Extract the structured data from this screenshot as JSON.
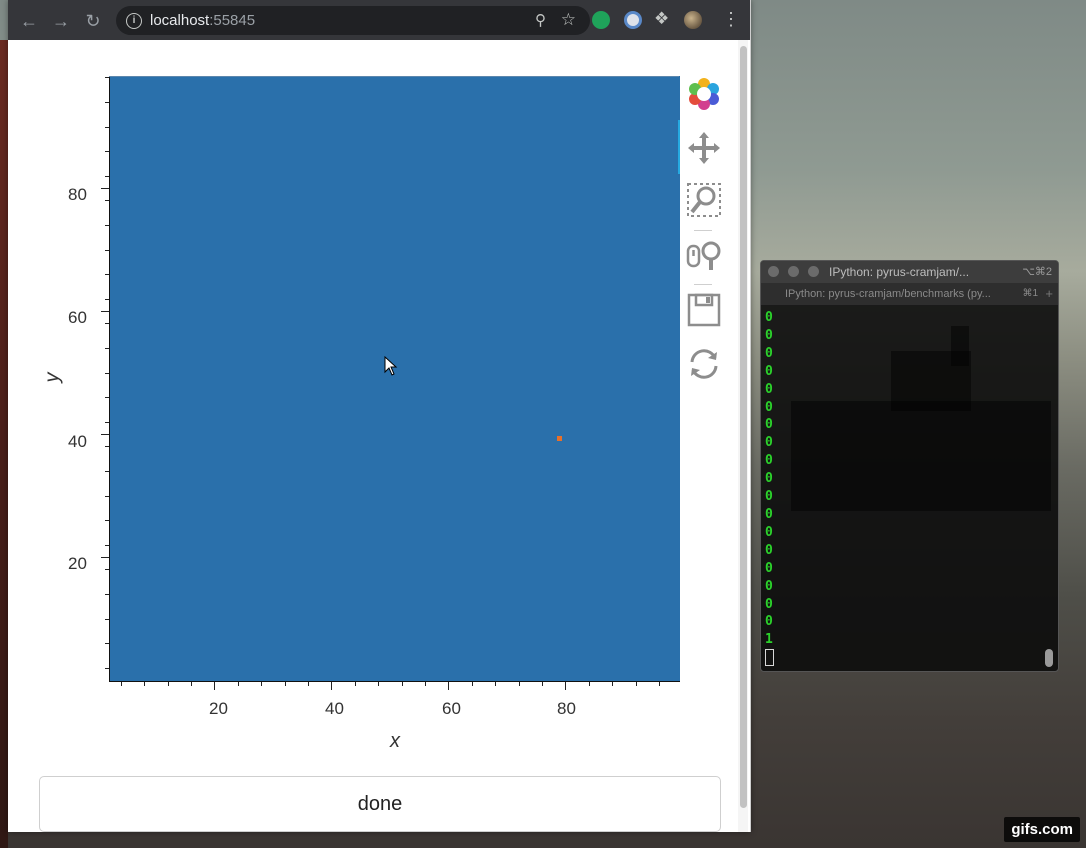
{
  "browser": {
    "url_host": "localhost",
    "url_port": ":55845",
    "icons": [
      "back-arrow-icon",
      "forward-arrow-icon",
      "reload-icon",
      "info-icon",
      "zoom-icon",
      "bookmark-star-icon",
      "extension-icon",
      "puzzle-icon",
      "profile-avatar",
      "menu-icon"
    ]
  },
  "plot": {
    "xlabel": "x",
    "ylabel": "y",
    "x_ticks": [
      "20",
      "40",
      "60",
      "80"
    ],
    "y_ticks": [
      "80",
      "60",
      "40",
      "20"
    ],
    "background_color": "#2a70ab",
    "marker_color": "#e8702a",
    "marker_x": 78,
    "marker_y": 40
  },
  "toolbar_tools": [
    "bokeh-logo-icon",
    "pan-icon",
    "box-zoom-icon",
    "wheel-zoom-icon",
    "save-icon",
    "reset-icon"
  ],
  "done_button": {
    "label": "done"
  },
  "terminal": {
    "title": "IPython: pyrus-cramjam/...",
    "shortcut": "⌥⌘2",
    "tab_label": "IPython: pyrus-cramjam/benchmarks (py...",
    "tab_shortcut": "⌘1",
    "lines": [
      "0",
      "0",
      "0",
      "0",
      "0",
      "0",
      "0",
      "0",
      "0",
      "0",
      "0",
      "0",
      "0",
      "0",
      "0",
      "0",
      "0",
      "0",
      "1"
    ]
  },
  "watermark": "gifs.com"
}
